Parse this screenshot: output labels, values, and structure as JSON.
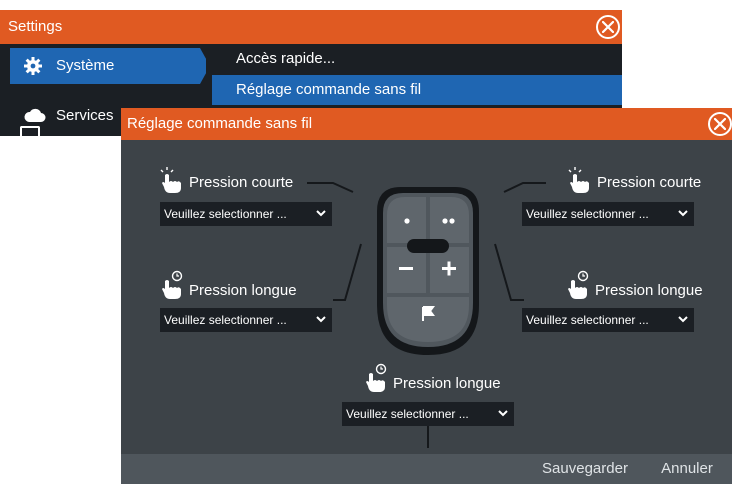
{
  "settings_window": {
    "title": "Settings",
    "sidebar": [
      {
        "label": "Système",
        "icon": "gear-icon",
        "active": true
      },
      {
        "label": "Services",
        "icon": "cloud-icon",
        "active": false
      }
    ],
    "menu": [
      {
        "label": "Accès rapide..."
      },
      {
        "label": "Réglage commande sans fil",
        "selected": true
      }
    ]
  },
  "dialog": {
    "title": "Réglage commande sans fil",
    "actions": [
      {
        "label": "Pression courte",
        "icon": "tap-icon",
        "select_value": "Veuillez selectionner ..."
      },
      {
        "label": "Pression courte",
        "icon": "tap-icon",
        "select_value": "Veuillez selectionner ..."
      },
      {
        "label": "Pression longue",
        "icon": "long-press-icon",
        "select_value": "Veuillez selectionner ..."
      },
      {
        "label": "Pression longue",
        "icon": "long-press-icon",
        "select_value": "Veuillez selectionner ..."
      },
      {
        "label": "Pression longue",
        "icon": "long-press-icon",
        "select_value": "Veuillez selectionner ..."
      }
    ],
    "footer": {
      "save_label": "Sauvegarder",
      "cancel_label": "Annuler"
    }
  },
  "colors": {
    "accent": "#e05a22",
    "selection": "#1f66b2",
    "panel": "#3d4348",
    "footer": "#4f565c"
  }
}
